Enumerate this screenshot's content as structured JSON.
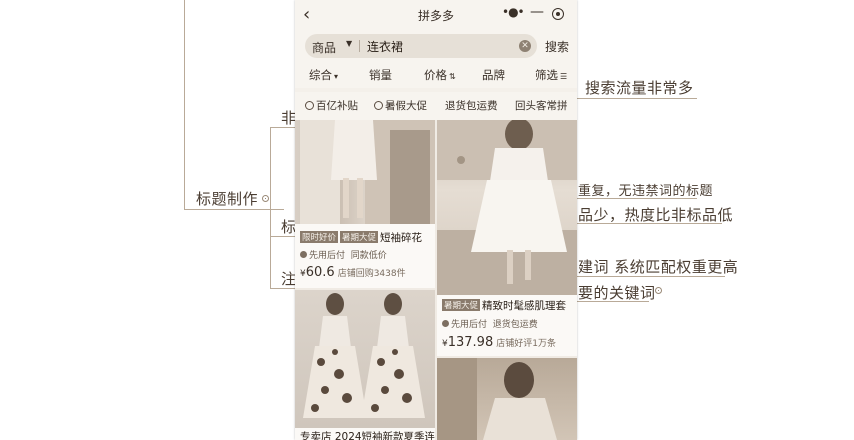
{
  "window": {
    "title": "拼多多"
  },
  "search": {
    "scope": "商品",
    "query": "连衣裙",
    "button": "搜索"
  },
  "sort": {
    "items": [
      {
        "label": "综合",
        "suffix": "▾"
      },
      {
        "label": "销量",
        "suffix": ""
      },
      {
        "label": "价格",
        "suffix": "⇅"
      },
      {
        "label": "品牌",
        "suffix": ""
      },
      {
        "label": "筛选",
        "suffix": "☰"
      }
    ]
  },
  "tags": [
    "百亿补贴",
    "暑假大促",
    "退货包运费",
    "回头客常拼"
  ],
  "products": [
    {
      "badges": [
        "限时好价",
        "暑期大促"
      ],
      "title": "短袖碎花",
      "meta1": "先用后付",
      "meta2": "同款低价",
      "currency": "¥",
      "price": "60.6",
      "sold": "店铺回购3438件"
    },
    {
      "badges": [
        "暑期大促"
      ],
      "title": "精致时髦感肌理套",
      "meta1": "先用后付",
      "meta2": "退货包运费",
      "currency": "¥",
      "price": "137.98",
      "sold": "店铺好评1万条"
    },
    {
      "badges": [],
      "title": "专卖店 2024短袖新款夏季连",
      "meta1": "",
      "meta2": "",
      "currency": "",
      "price": "",
      "sold": ""
    }
  ],
  "mindmap": {
    "root": "标题制作",
    "branch_fragments": [
      "非",
      "标",
      "注"
    ],
    "notes": [
      "搜索流量非常多",
      "重复，无违禁词的标题",
      "品少，热度比非标品低",
      "建词 系统匹配权重更高",
      "要的关键词"
    ]
  },
  "colors": {
    "background": "#ffffff",
    "line": "#b9aa98",
    "text": "#4a3d32",
    "phone_bg": "#f4f0ea"
  },
  "icons": [
    "back-icon",
    "more-icon",
    "minimize-icon",
    "record-icon",
    "caret-down-icon",
    "clear-icon",
    "sort-icon",
    "filter-icon"
  ]
}
